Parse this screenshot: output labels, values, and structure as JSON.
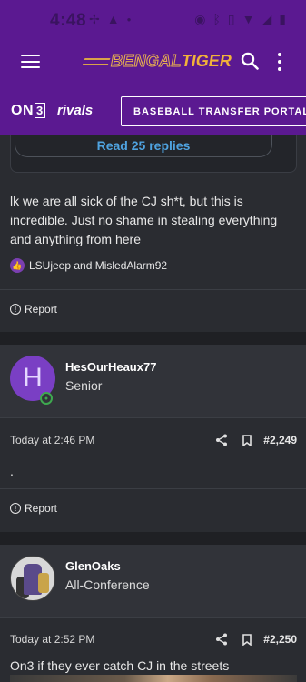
{
  "status_bar": {
    "time": "4:48",
    "left_icons": [
      "fan-icon",
      "warning-icon",
      "dot-icon"
    ],
    "right_icons": [
      "alarm-icon",
      "bluetooth-icon",
      "vibrate-icon",
      "wifi-icon",
      "signal-icon",
      "battery-icon"
    ]
  },
  "header": {
    "logo_part1": "BENGAL",
    "logo_part2": "TIGER",
    "menu_icon": "hamburger-icon",
    "search_icon": "search-icon",
    "more_icon": "kebab-icon"
  },
  "brand_bar": {
    "on3_text": "ON",
    "on3_box": "3",
    "rivals_text": "rivals",
    "portal_button": "BASEBALL TRANSFER PORTAL"
  },
  "post1": {
    "read_replies": "Read 25 replies",
    "text": "lk we are all sick of the CJ sh*t, but this is incredible. Just no shame in stealing everything and anything from here",
    "reactions": "LSUjeep and MisledAlarm92",
    "report": "Report"
  },
  "post2": {
    "avatar_letter": "H",
    "username": "HesOurHeaux77",
    "rank": "Senior",
    "time": "Today at 2:46 PM",
    "post_number": "#2,249",
    "text": ".",
    "report": "Report"
  },
  "post3": {
    "username": "GlenOaks",
    "rank": "All-Conference",
    "time": "Today at 2:52 PM",
    "post_number": "#2,250",
    "text": "On3 if they ever catch CJ in the streets"
  },
  "colors": {
    "header_purple": "#5b1991",
    "link_blue": "#4fa3e0",
    "logo_gold": "#f2b23a",
    "online_green": "#3ea84f"
  }
}
